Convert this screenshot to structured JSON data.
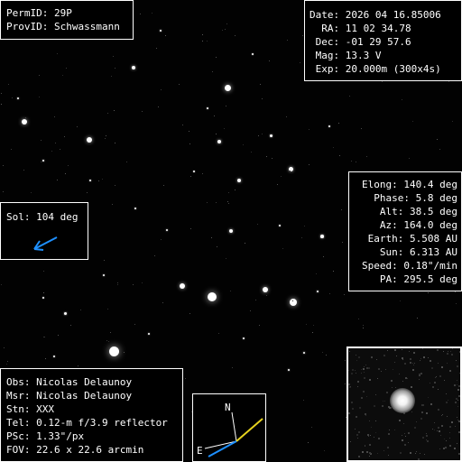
{
  "ids": {
    "permid_line": "PermID: 29P",
    "provid_line": "ProvID: Schwassmann"
  },
  "observation": {
    "lines": [
      "Date: 2026 04 16.85006",
      "  RA: 11 02 34.78",
      " Dec: -01 29 57.6",
      " Mag: 13.3 V",
      " Exp: 20.000m (300x4s)"
    ]
  },
  "geometry_panel": {
    "lines": [
      "Elong: 140.4 deg",
      "Phase: 5.8 deg",
      "Alt: 38.5 deg",
      "Az: 164.0 deg",
      "Earth: 5.508 AU",
      "Sun: 6.313 AU",
      "Speed: 0.18\"/min",
      "PA: 295.5 deg"
    ]
  },
  "sol": {
    "label": "Sol: 104 deg",
    "arrow_color": "#1e90ff"
  },
  "observer": {
    "lines": [
      "Obs: Nicolas Delaunoy",
      "Msr: Nicolas Delaunoy",
      "Stn: XXX",
      "Tel: 0.12-m f/3.9 reflector",
      "PSc: 1.33\"/px",
      "FOV: 22.6 x 22.6 arcmin"
    ]
  },
  "compass": {
    "north_label": "N",
    "east_label": "E",
    "motion_color": "#e6d21e",
    "sun_color": "#1e90ff"
  }
}
